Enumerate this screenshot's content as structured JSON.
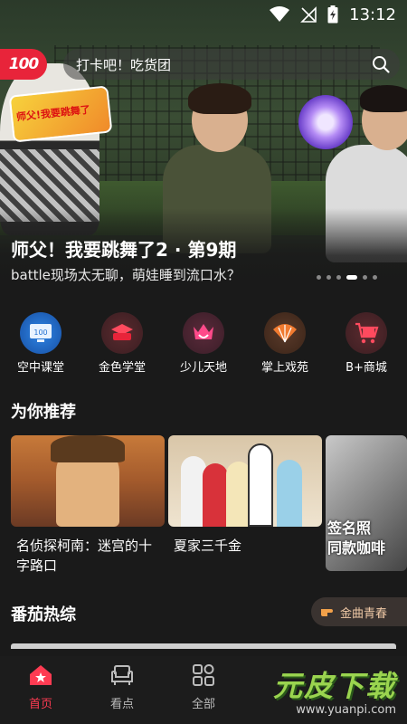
{
  "status_bar": {
    "time": "13:12"
  },
  "header": {
    "logo_text": "100",
    "search_placeholder": "打卡吧！吃货团"
  },
  "hero": {
    "title": "师父！我要跳舞了2 · 第9期",
    "subtitle": "battle现场太无聊，萌娃睡到流口水？",
    "dot_count": 6,
    "active_dot": 3
  },
  "categories": [
    {
      "label": "空中课堂",
      "icon": "air-classroom-icon",
      "color": "#1f6fd1"
    },
    {
      "label": "金色学堂",
      "icon": "golden-school-icon",
      "color": "#e8243a"
    },
    {
      "label": "少儿天地",
      "icon": "kids-world-icon",
      "color": "#e0306e"
    },
    {
      "label": "掌上戏苑",
      "icon": "opera-fan-icon",
      "color": "#f07a30"
    },
    {
      "label": "B+商城",
      "icon": "shopping-cart-icon",
      "color": "#e8243a"
    }
  ],
  "recommend": {
    "title": "为你推荐",
    "items": [
      {
        "title": "名侦探柯南：迷宫的十字路口"
      },
      {
        "title": "夏家三千金"
      }
    ]
  },
  "variety": {
    "title": "番茄热综",
    "tag": "金曲青春"
  },
  "tabs": [
    {
      "label": "首页",
      "icon": "home-icon",
      "active": true
    },
    {
      "label": "看点",
      "icon": "sofa-icon",
      "active": false
    },
    {
      "label": "全部",
      "icon": "grid-icon",
      "active": false
    }
  ],
  "watermark": {
    "main": "元皮下载",
    "url": "www.yuanpi.com"
  },
  "colors": {
    "accent": "#e8243a",
    "background": "#1a1a1a"
  }
}
